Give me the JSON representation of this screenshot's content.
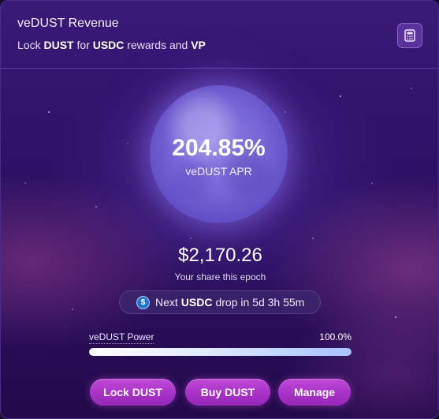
{
  "header": {
    "title": "veDUST Revenue",
    "subtitle_prefix": "Lock",
    "subtitle_token": "DUST",
    "subtitle_mid": "for",
    "subtitle_reward": "USDC",
    "subtitle_and": "rewards and",
    "subtitle_vp": "VP",
    "calculator_icon": "calculator-icon"
  },
  "apr": {
    "value": "204.85%",
    "label": "veDUST APR"
  },
  "share": {
    "amount": "$2,170.26",
    "label": "Your share this epoch"
  },
  "next_drop": {
    "icon": "usdc-coin-icon",
    "prefix": "Next",
    "token": "USDC",
    "suffix": "drop in 5d 3h 55m"
  },
  "power": {
    "label": "veDUST Power",
    "value": "100.0%",
    "fraction": 1.0
  },
  "buttons": {
    "lock": "Lock DUST",
    "buy": "Buy DUST",
    "manage": "Manage"
  },
  "colors": {
    "accent_button": "#a62fc6",
    "background": "#2c1164",
    "usdc_blue": "#2775ca"
  }
}
